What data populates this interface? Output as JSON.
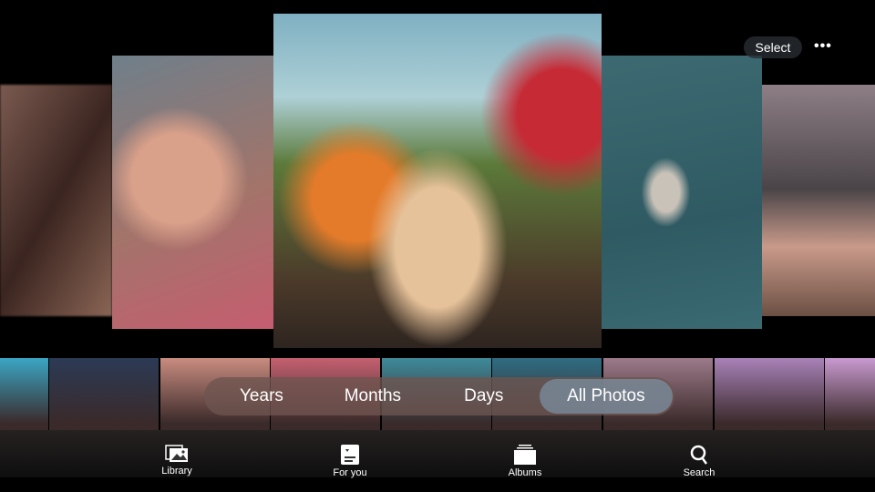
{
  "header": {
    "select_label": "Select",
    "more_icon": "ellipsis-icon"
  },
  "view_switcher": {
    "options": [
      "Years",
      "Months",
      "Days",
      "All Photos"
    ],
    "selected": "All Photos"
  },
  "tab_bar": {
    "items": [
      {
        "label": "Library",
        "icon": "photo-library-icon"
      },
      {
        "label": "For you",
        "icon": "for-you-icon"
      },
      {
        "label": "Albums",
        "icon": "albums-icon"
      },
      {
        "label": "Search",
        "icon": "search-icon"
      }
    ]
  },
  "thumbnail_colors": [
    "#3aa6c4",
    "#2c3a55",
    "#c98c80",
    "#c46070",
    "#3e8a9a",
    "#2f6c82",
    "#9c7a8a",
    "#a882b8",
    "#c89ad0"
  ]
}
